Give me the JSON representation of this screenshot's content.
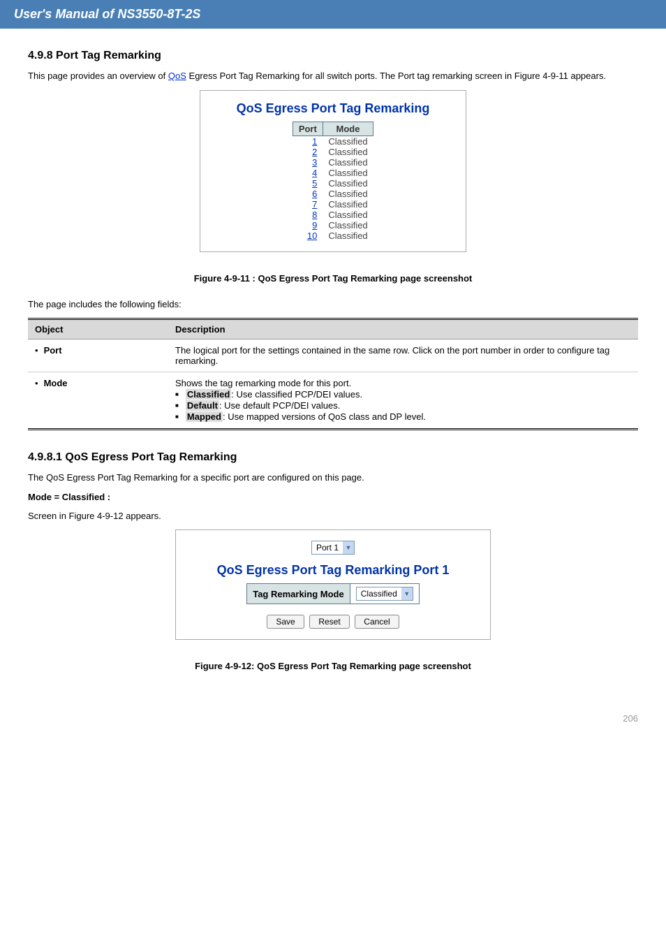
{
  "header_text": "User's Manual of NS3550-8T-2S",
  "section": {
    "title": "4.9.8 Port Tag Remarking",
    "desc_prefix": "This page provides an overview of ",
    "desc_link": "QoS",
    "desc_suffix": " Egress Port Tag Remarking for all switch ports. The Port tag remarking screen in Figure 4-9-11 appears."
  },
  "fig1": {
    "title": "QoS Egress Port Tag Remarking",
    "headers": [
      "Port",
      "Mode"
    ],
    "rows": [
      {
        "port": "1",
        "mode": "Classified"
      },
      {
        "port": "2",
        "mode": "Classified"
      },
      {
        "port": "3",
        "mode": "Classified"
      },
      {
        "port": "4",
        "mode": "Classified"
      },
      {
        "port": "5",
        "mode": "Classified"
      },
      {
        "port": "6",
        "mode": "Classified"
      },
      {
        "port": "7",
        "mode": "Classified"
      },
      {
        "port": "8",
        "mode": "Classified"
      },
      {
        "port": "9",
        "mode": "Classified"
      },
      {
        "port": "10",
        "mode": "Classified"
      }
    ],
    "caption": "Figure 4-9-11 : QoS Egress Port Tag Remarking page screenshot"
  },
  "desc_intro": "The page includes the following fields:",
  "desc_table": {
    "headers": [
      "Object",
      "Description"
    ],
    "rows": [
      {
        "object": "Port",
        "desc": "The logical port for the settings contained in the same row. Click on the port number in order to configure tag remarking."
      },
      {
        "object": "Mode",
        "desc_prefix": "Shows the tag remarking mode for this port.",
        "items": [
          {
            "label": "Classified",
            "text": ": Use classified PCP/DEI values."
          },
          {
            "label": "Default",
            "text": ": Use default PCP/DEI values."
          },
          {
            "label": "Mapped",
            "text": ": Use mapped versions of QoS class and DP level."
          }
        ]
      }
    ]
  },
  "mode_section": {
    "title": "4.9.8.1 QoS Egress Port Tag Remarking",
    "line1": "The QoS Egress Port Tag Remarking for a specific port are configured on this page.",
    "mode_label": "Mode = Classified :",
    "mode_desc": "Screen in Figure 4-9-12 appears."
  },
  "fig2": {
    "port_select": "Port 1",
    "title": "QoS Egress Port Tag Remarking  Port 1",
    "row_label": "Tag Remarking Mode",
    "row_value": "Classified",
    "buttons": [
      "Save",
      "Reset",
      "Cancel"
    ],
    "caption": "Figure 4-9-12: QoS Egress Port Tag Remarking page screenshot"
  },
  "footer": {
    "page": "206"
  }
}
